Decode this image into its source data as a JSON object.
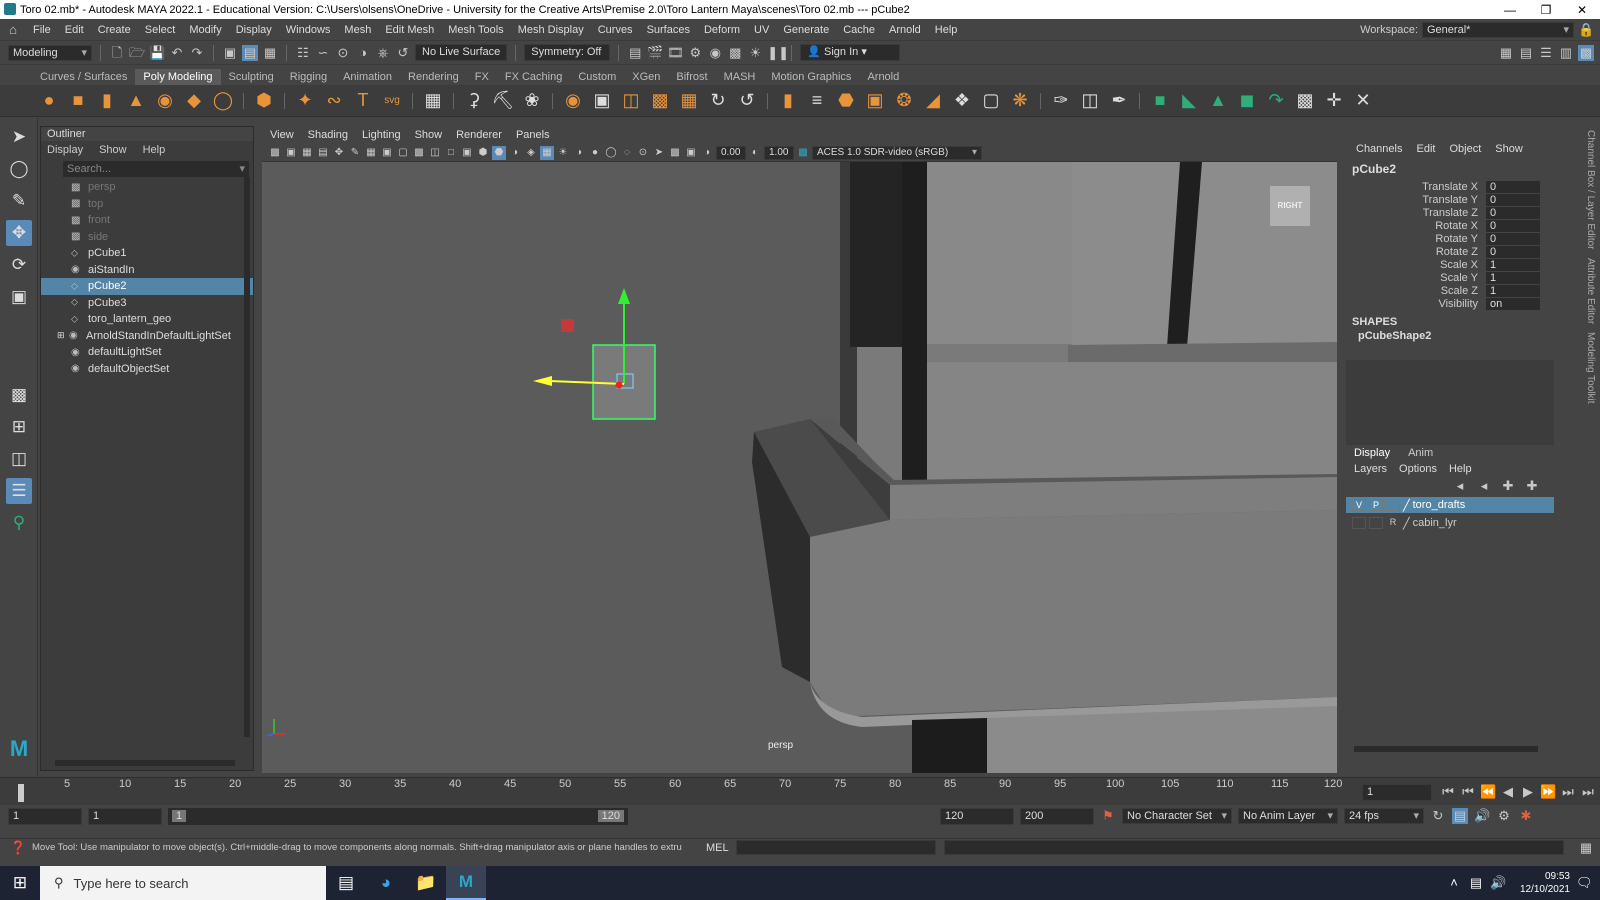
{
  "window": {
    "title": "Toro 02.mb* - Autodesk MAYA 2022.1 - Educational Version: C:\\Users\\olsens\\OneDrive - University for the Creative Arts\\Premise 2.0\\Toro Lantern Maya\\scenes\\Toro 02.mb  ---  pCube2"
  },
  "menubar": {
    "items": [
      "File",
      "Edit",
      "Create",
      "Select",
      "Modify",
      "Display",
      "Windows",
      "Mesh",
      "Edit Mesh",
      "Mesh Tools",
      "Mesh Display",
      "Curves",
      "Surfaces",
      "Deform",
      "UV",
      "Generate",
      "Cache",
      "Arnold",
      "Help"
    ],
    "workspace_label": "Workspace:",
    "workspace_value": "General*"
  },
  "statusline": {
    "mode": "Modeling",
    "live_surface": "No Live Surface",
    "symmetry": "Symmetry: Off",
    "sign_in": "Sign In"
  },
  "shelf": {
    "tabs": [
      "Curves / Surfaces",
      "Poly Modeling",
      "Sculpting",
      "Rigging",
      "Animation",
      "Rendering",
      "FX",
      "FX Caching",
      "Custom",
      "XGen",
      "Bifrost",
      "MASH",
      "Motion Graphics",
      "Arnold"
    ],
    "active_tab": "Poly Modeling"
  },
  "outliner": {
    "title": "Outliner",
    "menu": [
      "Display",
      "Show",
      "Help"
    ],
    "search_placeholder": "Search...",
    "items": [
      {
        "label": "persp",
        "icon": "camera-icon"
      },
      {
        "label": "top",
        "icon": "camera-icon"
      },
      {
        "label": "front",
        "icon": "camera-icon"
      },
      {
        "label": "side",
        "icon": "camera-icon"
      },
      {
        "label": "pCube1",
        "icon": "mesh-icon"
      },
      {
        "label": "aiStandIn",
        "icon": "standin-icon"
      },
      {
        "label": "pCube2",
        "icon": "mesh-icon"
      },
      {
        "label": "pCube3",
        "icon": "mesh-icon"
      },
      {
        "label": "toro_lantern_geo",
        "icon": "mesh-icon"
      },
      {
        "label": "ArnoldStandInDefaultLightSet",
        "icon": "set-icon"
      },
      {
        "label": "defaultLightSet",
        "icon": "set-icon"
      },
      {
        "label": "defaultObjectSet",
        "icon": "set-icon"
      }
    ]
  },
  "viewport": {
    "menu": [
      "View",
      "Shading",
      "Lighting",
      "Show",
      "Renderer",
      "Panels"
    ],
    "exposure": "0.00",
    "gamma": "1.00",
    "color_space": "ACES 1.0 SDR-video (sRGB)",
    "camera_label": "persp",
    "view_cube_label": "RIGHT"
  },
  "channelbox": {
    "menu": [
      "Channels",
      "Edit",
      "Object",
      "Show"
    ],
    "object": "pCube2",
    "attributes": [
      {
        "name": "Translate X",
        "value": "0"
      },
      {
        "name": "Translate Y",
        "value": "0"
      },
      {
        "name": "Translate Z",
        "value": "0"
      },
      {
        "name": "Rotate X",
        "value": "0"
      },
      {
        "name": "Rotate Y",
        "value": "0"
      },
      {
        "name": "Rotate Z",
        "value": "0"
      },
      {
        "name": "Scale X",
        "value": "1"
      },
      {
        "name": "Scale Y",
        "value": "1"
      },
      {
        "name": "Scale Z",
        "value": "1"
      },
      {
        "name": "Visibility",
        "value": "on"
      }
    ],
    "shapes_heading": "SHAPES",
    "shape_name": "pCubeShape2"
  },
  "layers": {
    "tabs": [
      "Display",
      "Anim"
    ],
    "menu": [
      "Layers",
      "Options",
      "Help"
    ],
    "rows": [
      {
        "v": "V",
        "p": "P",
        "name": "toro_drafts"
      },
      {
        "v": "",
        "p": "R",
        "name": "cabin_lyr"
      }
    ]
  },
  "sidetabs": [
    "Channel Box / Layer Editor",
    "Attribute Editor",
    "Modeling Toolkit"
  ],
  "timeline": {
    "ticks": [
      "5",
      "10",
      "15",
      "20",
      "25",
      "30",
      "35",
      "40",
      "45",
      "50",
      "55",
      "60",
      "65",
      "70",
      "75",
      "80",
      "85",
      "90",
      "95",
      "100",
      "105",
      "110",
      "115",
      "120"
    ],
    "current_frame": "1"
  },
  "range": {
    "start": "1",
    "playback_start": "1",
    "slider_start": "1",
    "slider_end": "120",
    "playback_end": "120",
    "end": "200",
    "character_set": "No Character Set",
    "anim_layer": "No Anim Layer",
    "fps": "24 fps"
  },
  "helpline": {
    "text": "Move Tool: Use manipulator to move object(s). Ctrl+middle-drag to move components along normals. Shift+drag manipulator axis or plane handles to extrude components or c",
    "mel_label": "MEL"
  },
  "taskbar": {
    "search_placeholder": "Type here to search",
    "time": "09:53",
    "date": "12/10/2021"
  }
}
